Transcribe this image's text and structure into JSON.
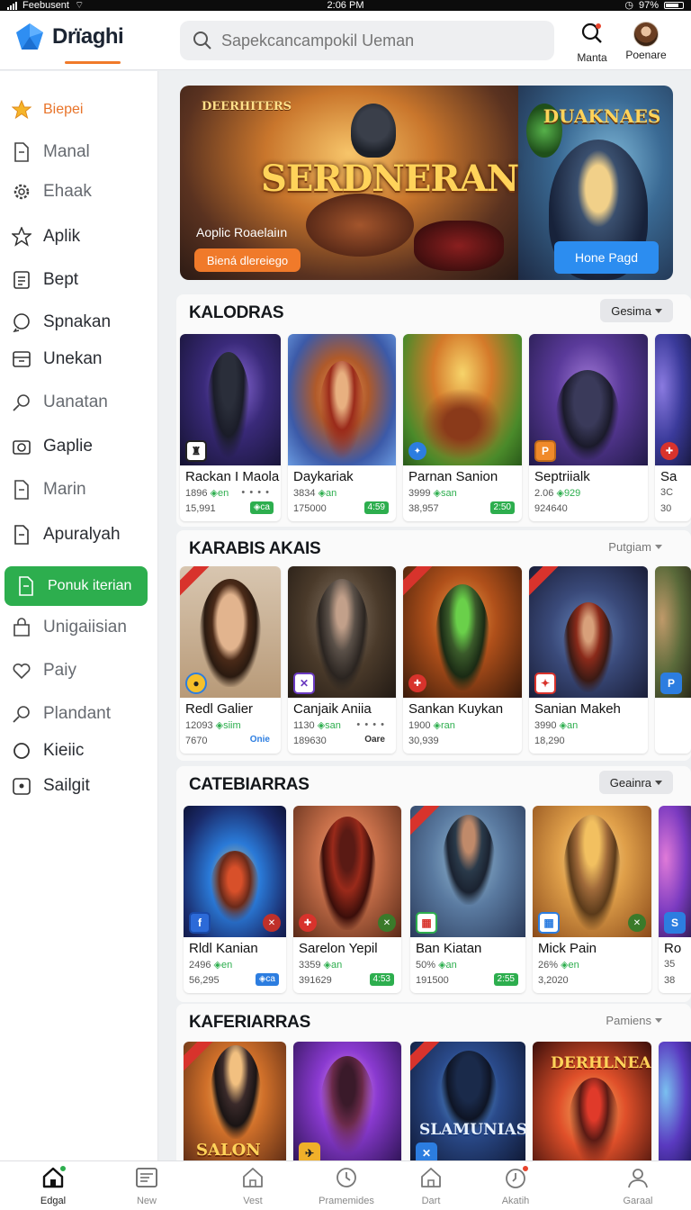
{
  "status_bar": {
    "carrier": "Feebusent",
    "time": "2:06 PM",
    "battery": "97%"
  },
  "app": {
    "name": "Drïaghi",
    "accent": "#f07a2a",
    "green": "#2dae4e",
    "blue": "#2c8df0"
  },
  "search": {
    "placeholder": "Sapekcancampokil Ueman"
  },
  "header_actions": [
    {
      "label": "Manta",
      "icon": "search-icon"
    },
    {
      "label": "Poenare",
      "icon": "avatar"
    }
  ],
  "sidebar": {
    "items": [
      {
        "label": "Biepei",
        "icon": "star-icon"
      },
      {
        "label": "Manal",
        "icon": "document-icon"
      },
      {
        "label": "Ehaak",
        "icon": "gear-icon"
      },
      {
        "label": "Aplik",
        "icon": "star-outline-icon"
      },
      {
        "label": "Bept",
        "icon": "list-icon"
      },
      {
        "label": "Spnakan",
        "icon": "chat-icon"
      },
      {
        "label": "Unekan",
        "icon": "inbox-icon"
      },
      {
        "label": "Uanatan",
        "icon": "search-icon"
      },
      {
        "label": "Gaplie",
        "icon": "camera-icon"
      },
      {
        "label": "Marin",
        "icon": "document-icon"
      },
      {
        "label": "Apuralyah",
        "icon": "document-icon"
      },
      {
        "label": "Ponuk iterian",
        "icon": "document-icon"
      },
      {
        "label": "Unigaiisian",
        "icon": "bag-icon"
      },
      {
        "label": "Paiy",
        "icon": "heart-icon"
      },
      {
        "label": "Plandant",
        "icon": "search-icon"
      },
      {
        "label": "Kieiic",
        "icon": "circle-icon"
      },
      {
        "label": "Sailgit",
        "icon": "plus-box-icon"
      }
    ]
  },
  "banner": {
    "badge": "DEERHITERS",
    "title": "SERDNERAN",
    "subtitle": "Aoplic Roaelaiın",
    "cta": "Biená dlereiego",
    "right_title": "DUAKNAES",
    "right_cta": "Hone Pagd"
  },
  "sections": [
    {
      "title": "KALODRAS",
      "filter": "Gesima",
      "cards": [
        {
          "name": "Rackan I Maola",
          "rating": "1896",
          "tag": "◈en",
          "downloads": "15,991",
          "pill": "◈ca"
        },
        {
          "name": "Daykariak",
          "rating": "3834",
          "tag": "◈an",
          "downloads": "175000",
          "pill": "4:59"
        },
        {
          "name": "Parnan Sanion",
          "rating": "3999",
          "tag": "◈san",
          "downloads": "38,957",
          "pill": "2:50"
        },
        {
          "name": "Septriialk",
          "rating": "2.06",
          "tag": "◈929",
          "downloads": "924640",
          "pill": ""
        },
        {
          "name": "Sa",
          "rating": "3C",
          "tag": "",
          "downloads": "30",
          "pill": ""
        }
      ]
    },
    {
      "title": "KARABIS AKAIS",
      "filter": "Putgiam",
      "cards": [
        {
          "name": "Redl Galier",
          "rating": "12093",
          "tag": "◈siim",
          "downloads": "7670",
          "pill": "Onie"
        },
        {
          "name": "Canjaik Aniia",
          "rating": "1130",
          "tag": "◈san",
          "downloads": "189630",
          "pill": "Oare"
        },
        {
          "name": "Sankan Kuykan",
          "rating": "1900",
          "tag": "◈ran",
          "downloads": "30,939",
          "pill": ""
        },
        {
          "name": "Sanian Makeh",
          "rating": "3990",
          "tag": "◈an",
          "downloads": "18,290",
          "pill": ""
        }
      ]
    },
    {
      "title": "CATEBIARRAS",
      "filter": "Geainra",
      "cards": [
        {
          "name": "Rldl Kanian",
          "rating": "2496",
          "tag": "◈en",
          "downloads": "56,295",
          "pill": "◈ca"
        },
        {
          "name": "Sarelon Yepil",
          "rating": "3359",
          "tag": "◈an",
          "downloads": "391629",
          "pill": "4:53"
        },
        {
          "name": "Ban Kiatan",
          "rating": "50%",
          "tag": "◈an",
          "downloads": "191500",
          "pill": "2:55"
        },
        {
          "name": "Mick Pain",
          "rating": "26%",
          "tag": "◈en",
          "downloads": "3,2020",
          "pill": ""
        },
        {
          "name": "Ro",
          "rating": "35",
          "tag": "",
          "downloads": "38",
          "pill": ""
        }
      ]
    },
    {
      "title": "KAFERIARRAS",
      "filter": "Pamiens",
      "cards": [
        {
          "name": "",
          "art_text": "SALON"
        },
        {
          "name": "",
          "art_text": ""
        },
        {
          "name": "",
          "art_text": "SLAMUNIAS"
        },
        {
          "name": "",
          "art_text": "DERHLNEAS"
        },
        {
          "name": "",
          "art_text": ""
        }
      ]
    }
  ],
  "bottom_nav": [
    {
      "label": "Edgal",
      "icon": "home-icon"
    },
    {
      "label": "New",
      "icon": "image-icon"
    },
    {
      "label": "Vest",
      "icon": "house-outline-icon"
    },
    {
      "label": "Pramemides",
      "icon": "clock-icon"
    },
    {
      "label": "Dart",
      "icon": "house-outline-icon"
    },
    {
      "label": "Akatih",
      "icon": "stopwatch-icon"
    },
    {
      "label": "Garaal",
      "icon": "user-icon"
    }
  ]
}
